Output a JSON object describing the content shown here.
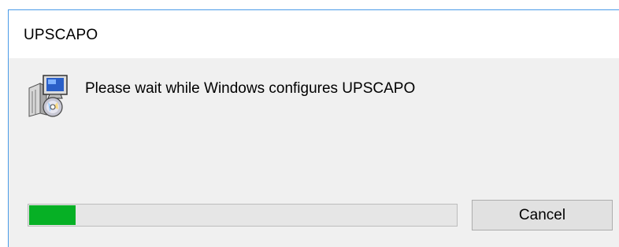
{
  "window": {
    "title": "UPSCAPO"
  },
  "dialog": {
    "message": "Please wait while Windows configures UPSCAPO",
    "icon": "installer-icon",
    "progress_fraction": 0.108
  },
  "buttons": {
    "cancel_label": "Cancel"
  },
  "colors": {
    "title_bar": "#ffffff",
    "window_border": "#4a9be8",
    "body": "#f0f0f0",
    "progress_fill": "#06b025"
  }
}
